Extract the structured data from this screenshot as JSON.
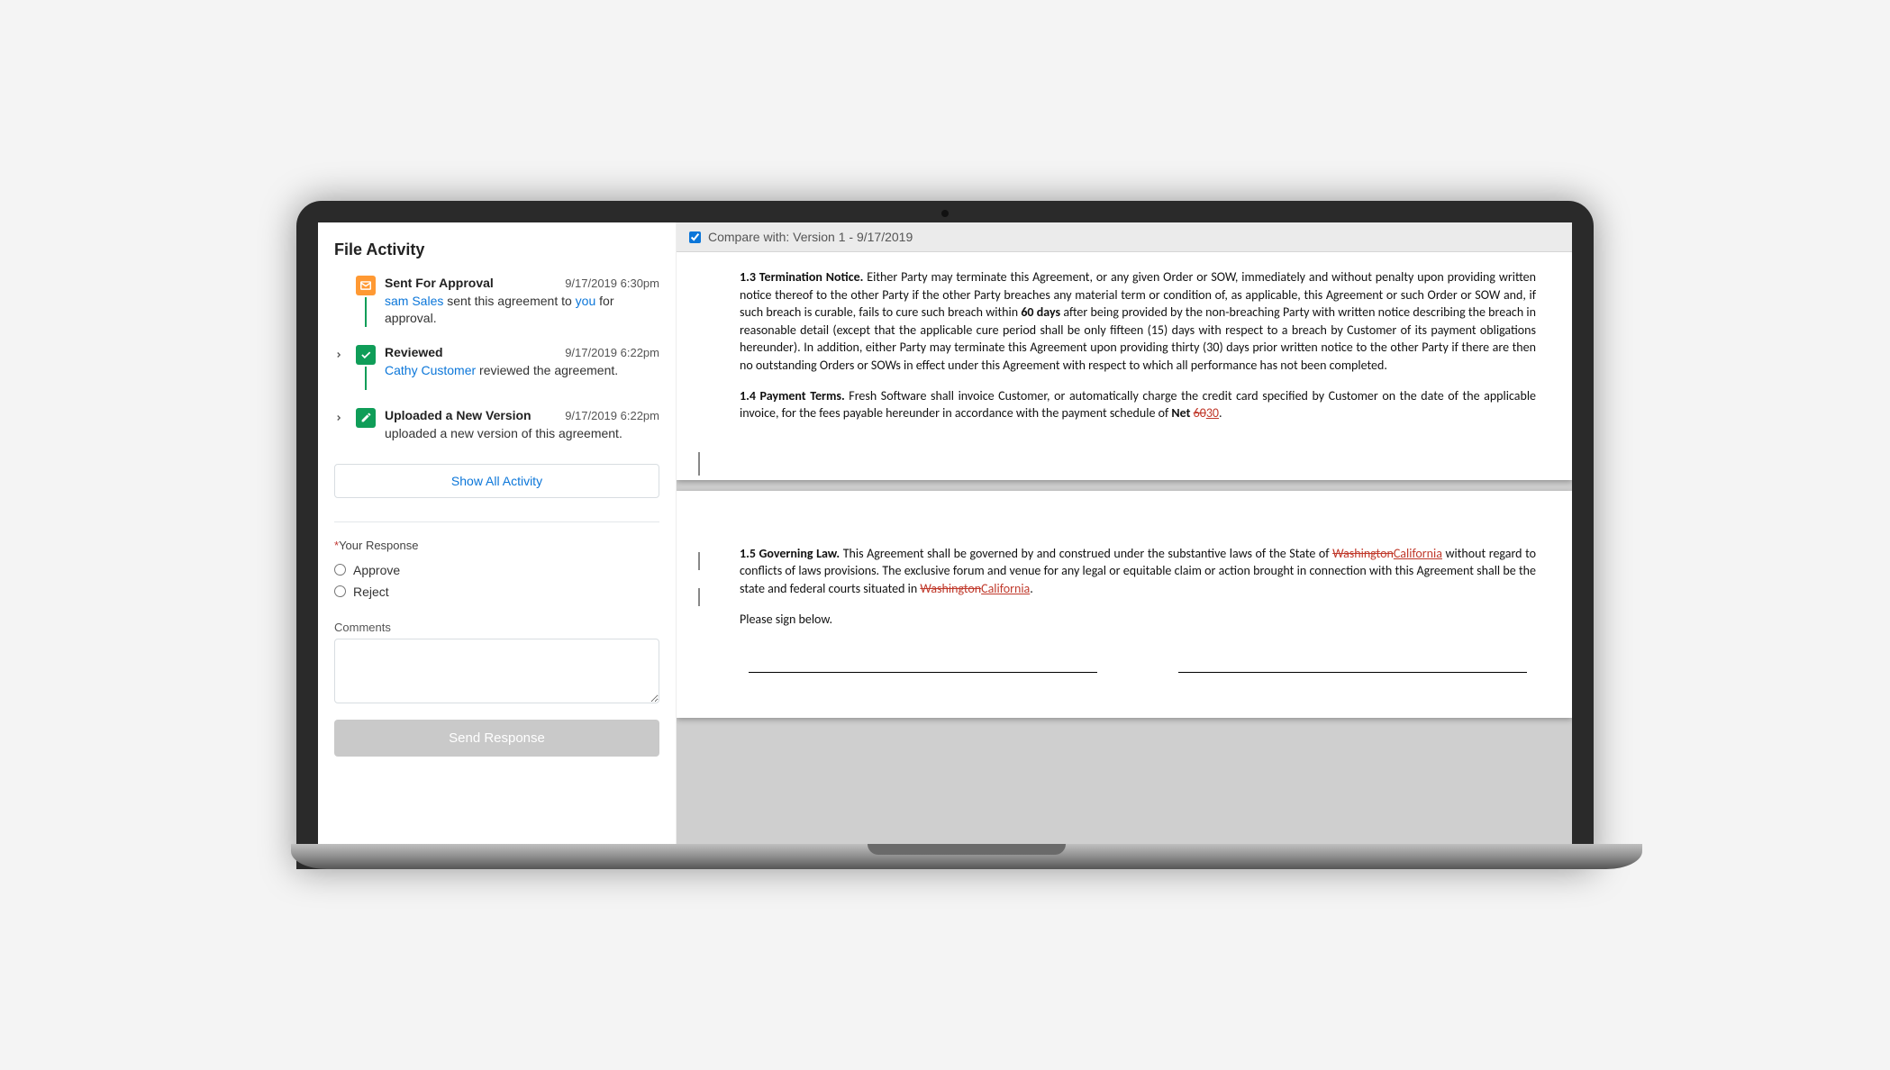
{
  "sidebar": {
    "heading": "File Activity",
    "show_all_label": "Show All Activity",
    "items": [
      {
        "title": "Sent For Approval",
        "timestamp": "9/17/2019 6:30pm",
        "desc_pre": "",
        "actor": "sam Sales",
        "desc_mid": " sent this agreement to ",
        "target": "you",
        "desc_post": " for approval.",
        "icon": "mail",
        "has_chevron": false,
        "has_line": true
      },
      {
        "title": "Reviewed",
        "timestamp": "9/17/2019 6:22pm",
        "desc_pre": "",
        "actor": "Cathy Customer",
        "desc_mid": " reviewed the agreement.",
        "target": "",
        "desc_post": "",
        "icon": "check",
        "has_chevron": true,
        "has_line": true
      },
      {
        "title": "Uploaded a New Version",
        "timestamp": "9/17/2019 6:22pm",
        "desc_pre": "uploaded a new version of this agreement.",
        "actor": "",
        "desc_mid": "",
        "target": "",
        "desc_post": "",
        "icon": "pencil",
        "has_chevron": true,
        "has_line": false
      }
    ]
  },
  "response_form": {
    "label": "Your Response",
    "approve_label": "Approve",
    "reject_label": "Reject",
    "comments_label": "Comments",
    "send_label": "Send Response"
  },
  "compare": {
    "label": "Compare with:  Version 1 - 9/17/2019"
  },
  "document": {
    "section_13_title": "1.3 Termination Notice.",
    "section_13_body_a": " Either Party may terminate this Agreement, or any given Order or SOW, immediately and without penalty upon providing written notice thereof to the other Party if the other Party breaches any material term or condition of, as applicable, this Agreement or such Order or SOW and, if such breach is curable, fails to cure such breach within ",
    "section_13_bold": "60 days",
    "section_13_body_b": " after being provided by the non-breaching Party with written notice describing the breach in reasonable detail (except that the applicable cure period shall be only fifteen (15) days with respect to a breach by Customer of its payment obligations hereunder). In addition, either Party may terminate this Agreement upon providing thirty (30) days prior written notice to the other Party if there are then no outstanding Orders or SOWs in effect under this Agreement with respect to which all performance has not been completed.",
    "section_14_title": "1.4 Payment Terms.",
    "section_14_body_a": " Fresh Software shall invoice Customer, or automatically charge the credit card specified by Customer on the date of the applicable invoice, for the fees payable hereunder in accordance with the payment schedule of ",
    "section_14_net": "Net ",
    "section_14_strike": "60",
    "section_14_ins": "30",
    "section_14_body_b": ".",
    "section_15_title": "1.5 Governing Law.",
    "section_15_body_a": "  This Agreement shall be governed by and construed under the substantive laws of the State of ",
    "section_15_strike1": "Washington",
    "section_15_ins1": "California",
    "section_15_body_b": " without regard to conflicts of laws provisions. The exclusive forum and venue for any legal or equitable claim or action brought in connection with this Agreement shall be the state and federal courts situated in ",
    "section_15_strike2": "Washington",
    "section_15_ins2": "California",
    "section_15_body_c": ".",
    "sign_prompt": "Please sign below."
  }
}
